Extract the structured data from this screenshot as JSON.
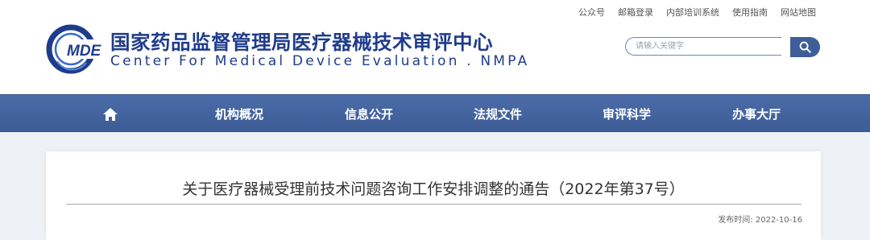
{
  "top_links": [
    "公众号",
    "邮箱登录",
    "内部培训系统",
    "使用指南",
    "网站地图"
  ],
  "logo": {
    "mark_text": "MDE",
    "cn_name": "国家药品监督管理局医疗器械技术审评中心",
    "en_name": "Center For Medical Device Evaluation . NMPA"
  },
  "search": {
    "placeholder": "请输入关键字",
    "icon": "search-icon"
  },
  "nav": {
    "home_icon": "home-icon",
    "items": [
      "机构概况",
      "信息公开",
      "法规文件",
      "审评科学",
      "办事大厅"
    ]
  },
  "article": {
    "title": "关于医疗器械受理前技术问题咨询工作安排调整的通告（2022年第37号）",
    "publish_label": "发布时间:",
    "publish_date": "2022-10-16"
  },
  "colors": {
    "brand_blue": "#1f3c8c",
    "nav_bg": "#4565a1",
    "search_button": "#3e5e9a",
    "page_bg": "#eef1f5"
  }
}
